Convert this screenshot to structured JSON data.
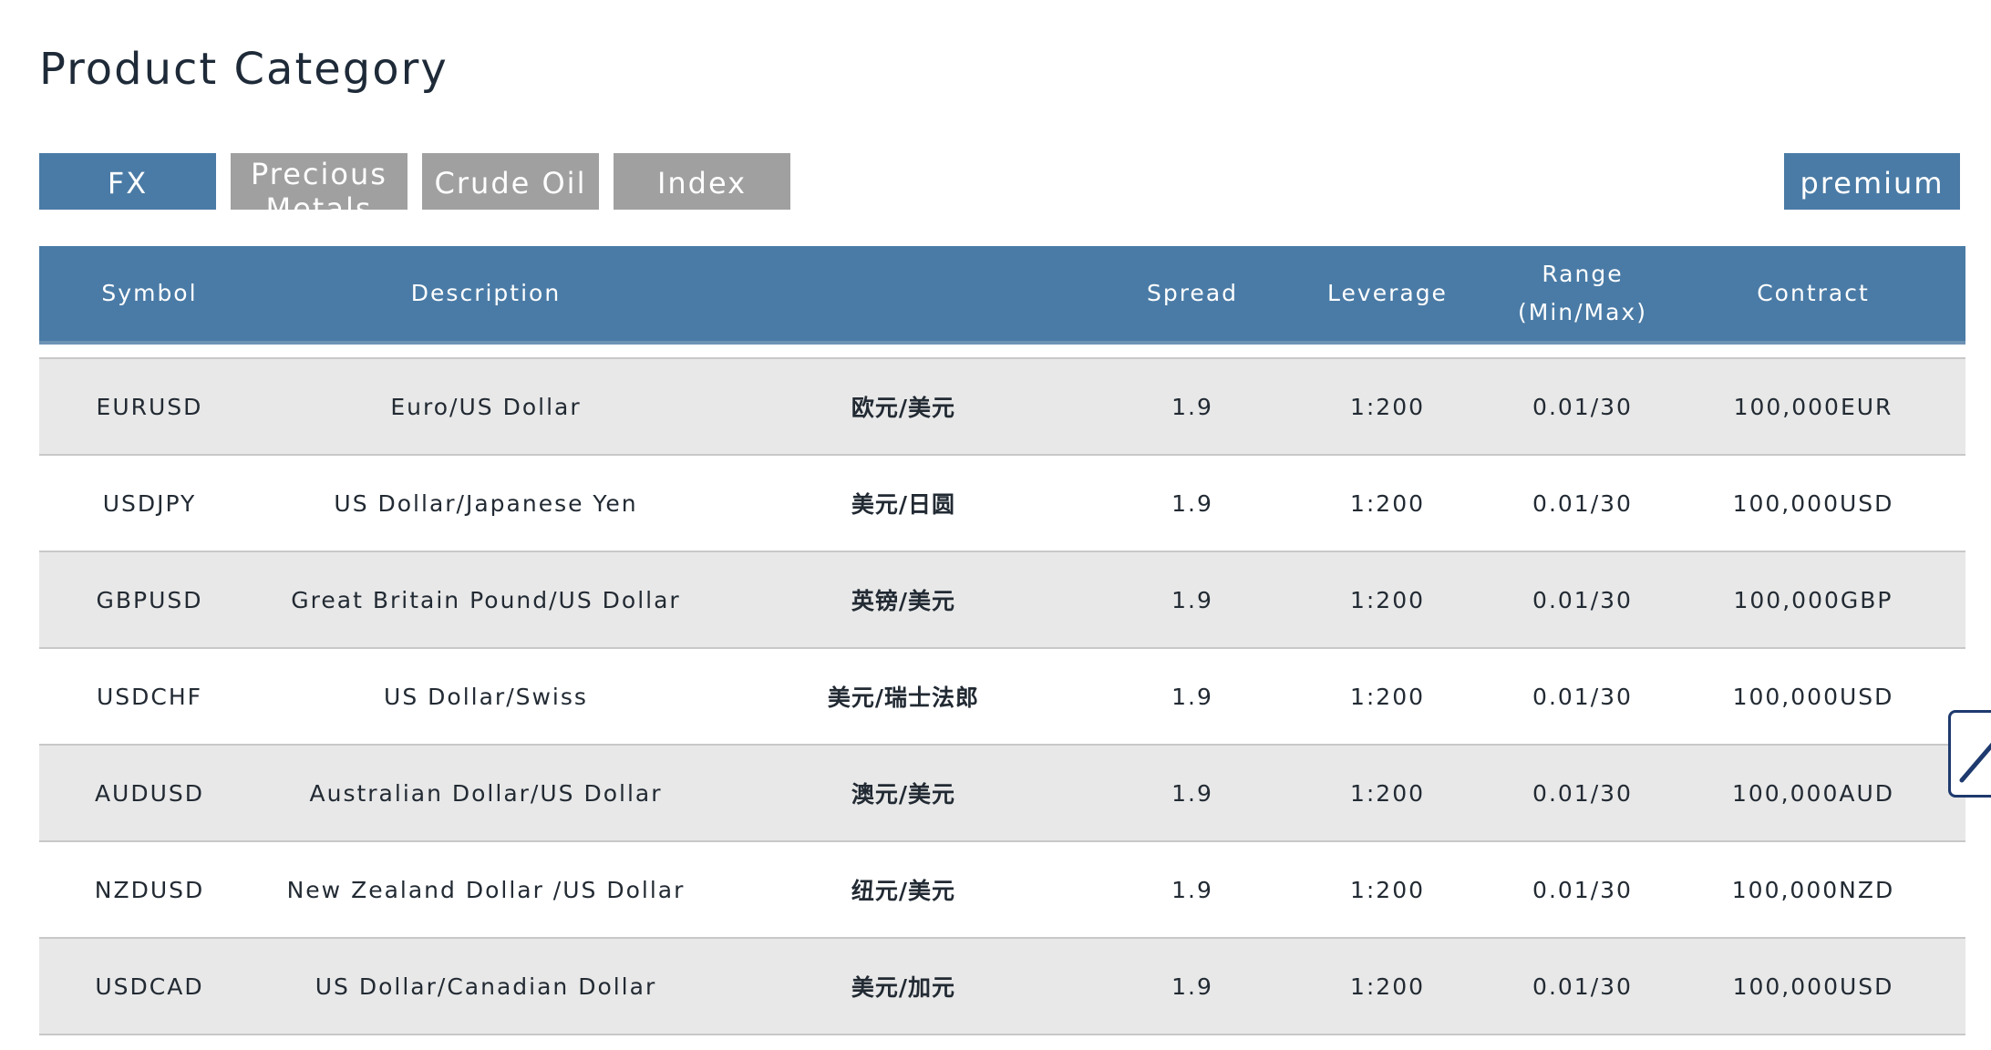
{
  "page": {
    "title": "Product Category"
  },
  "tabs": [
    {
      "label": "FX",
      "active": true
    },
    {
      "label": "Precious Metals",
      "active": false
    },
    {
      "label": "Crude Oil",
      "active": false
    },
    {
      "label": "Index",
      "active": false
    }
  ],
  "premium_label": "premium",
  "table": {
    "headers": {
      "symbol": "Symbol",
      "description": "Description",
      "spread": "Spread",
      "leverage": "Leverage",
      "range_line1": "Range",
      "range_line2": "(Min/Max)",
      "contract": "Contract"
    },
    "rows": [
      {
        "symbol": "EURUSD",
        "description": "Euro/US Dollar",
        "cn": "欧元/美元",
        "spread": "1.9",
        "leverage": "1:200",
        "range": "0.01/30",
        "contract": "100,000EUR"
      },
      {
        "symbol": "USDJPY",
        "description": "US Dollar/Japanese Yen",
        "cn": "美元/日圆",
        "spread": "1.9",
        "leverage": "1:200",
        "range": "0.01/30",
        "contract": "100,000USD"
      },
      {
        "symbol": "GBPUSD",
        "description": "Great Britain Pound/US Dollar",
        "cn": "英镑/美元",
        "spread": "1.9",
        "leverage": "1:200",
        "range": "0.01/30",
        "contract": "100,000GBP"
      },
      {
        "symbol": "USDCHF",
        "description": "US Dollar/Swiss",
        "cn": "美元/瑞士法郎",
        "spread": "1.9",
        "leverage": "1:200",
        "range": "0.01/30",
        "contract": "100,000USD"
      },
      {
        "symbol": "AUDUSD",
        "description": "Australian Dollar/US Dollar",
        "cn": "澳元/美元",
        "spread": "1.9",
        "leverage": "1:200",
        "range": "0.01/30",
        "contract": "100,000AUD"
      },
      {
        "symbol": "NZDUSD",
        "description": "New Zealand Dollar /US Dollar",
        "cn": "纽元/美元",
        "spread": "1.9",
        "leverage": "1:200",
        "range": "0.01/30",
        "contract": "100,000NZD"
      },
      {
        "symbol": "USDCAD",
        "description": "US Dollar/Canadian Dollar",
        "cn": "美元/加元",
        "spread": "1.9",
        "leverage": "1:200",
        "range": "0.01/30",
        "contract": "100,000USD"
      }
    ]
  },
  "colors": {
    "accent": "#4a7ba6",
    "tab_inactive": "#a0a0a0",
    "row_alt": "#e8e8e8",
    "widget_border": "#1e3a6e"
  },
  "icons": {
    "edit_widget": "edit-pencil-icon"
  }
}
